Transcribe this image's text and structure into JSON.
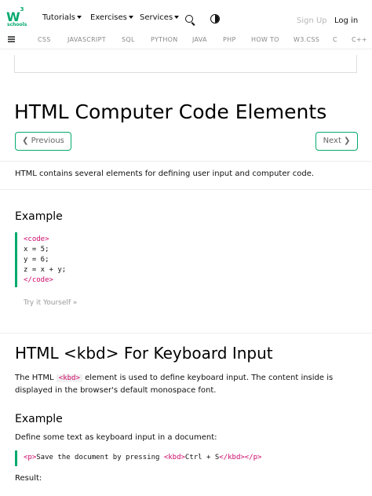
{
  "logo": {
    "mark": "W",
    "superscript": "3",
    "sub": "schools"
  },
  "nav": {
    "items": [
      "Tutorials",
      "Exercises",
      "Services"
    ],
    "signup": "Sign Up",
    "login": "Log in"
  },
  "subnav": [
    "CSS",
    "JAVASCRIPT",
    "SQL",
    "PYTHON",
    "JAVA",
    "PHP",
    "HOW TO",
    "W3.CSS",
    "C",
    "C++"
  ],
  "page": {
    "title": "HTML Computer Code Elements",
    "prev": "❮ Previous",
    "next": "Next ❯",
    "intro": "HTML contains several elements for defining user input and computer code."
  },
  "example1": {
    "title": "Example",
    "code": {
      "open_tag": "<code>",
      "line1": "x = 5;",
      "line2": "y = 6;",
      "line3": "z = x + y;",
      "close_tag": "</code>"
    },
    "try_label": "Try it Yourself »"
  },
  "kbd_section": {
    "title": "HTML <kbd> For Keyboard Input",
    "desc_before": "The HTML ",
    "desc_tag": "<kbd>",
    "desc_after": " element is used to define keyboard input. The content inside is displayed in the browser's default monospace font."
  },
  "example2": {
    "title": "Example",
    "desc": "Define some text as keyboard input in a document:",
    "code": {
      "p_open": "<p>",
      "text": "Save the document by pressing ",
      "kbd_open": "<kbd>",
      "keys": "Ctrl + S",
      "kbd_close": "</kbd>",
      "p_close": "</p>"
    },
    "result_label": "Result:"
  }
}
